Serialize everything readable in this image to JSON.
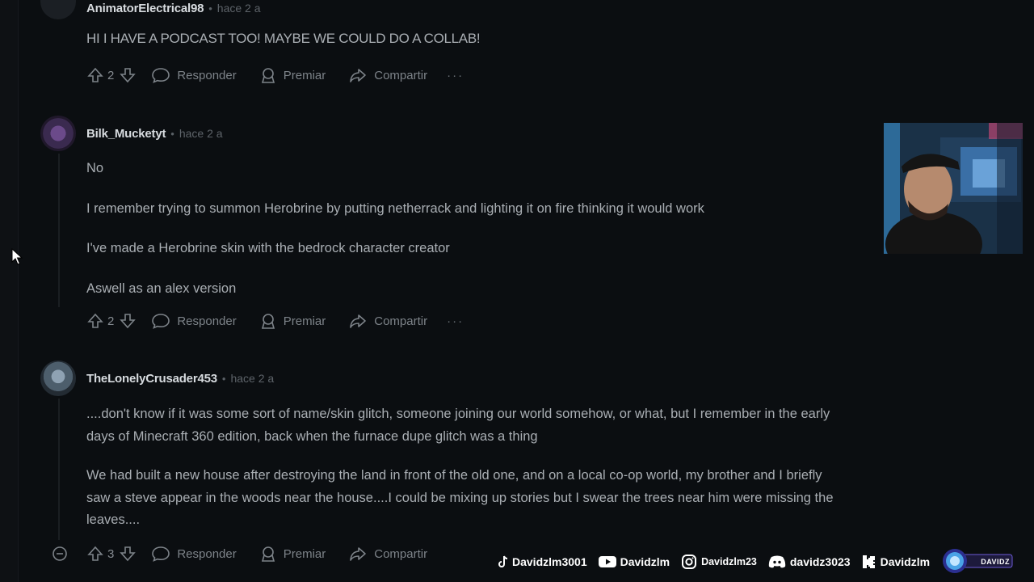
{
  "comments": [
    {
      "username": "AnimatorElectrical98",
      "time": "hace 2 a",
      "paragraphs": [
        "HI I HAVE A PODCAST TOO! MAYBE WE COULD DO A COLLAB!"
      ],
      "votes": "2"
    },
    {
      "username": "Bilk_Mucketyt",
      "time": "hace 2 a",
      "paragraphs": [
        "No",
        "I remember trying to summon Herobrine by putting netherrack and lighting it on fire thinking it would work",
        "I've made a Herobrine skin with the bedrock character creator",
        "Aswell as an alex version"
      ],
      "votes": "2"
    },
    {
      "username": "TheLonelyCrusader453",
      "time": "hace 2 a",
      "paragraphs": [
        "....don't know if it was some sort of name/skin glitch, someone joining our world somehow, or what, but I remember in the early days of Minecraft 360 edition, back when the furnace dupe glitch was a thing",
        "We had built a new house after destroying the land in front of the old one, and on a local co-op world, my brother and I briefly saw a steve appear in the woods near the house....I could be mixing up stories but I swear the trees near him were missing the leaves...."
      ],
      "votes": "3"
    }
  ],
  "actions": {
    "reply": "Responder",
    "award": "Premiar",
    "share": "Compartir",
    "more": "···"
  },
  "socials": {
    "tiktok": "Davidzlm3001",
    "youtube": "Davidzlm",
    "instagram": "Davidzlm23",
    "discord": "davidz3023",
    "kick": "Davidzlm",
    "logo_text": "DAVIDZ"
  },
  "colors": {
    "background": "#0b0e11",
    "text": "#a9aeb3",
    "muted": "#7d8389"
  }
}
